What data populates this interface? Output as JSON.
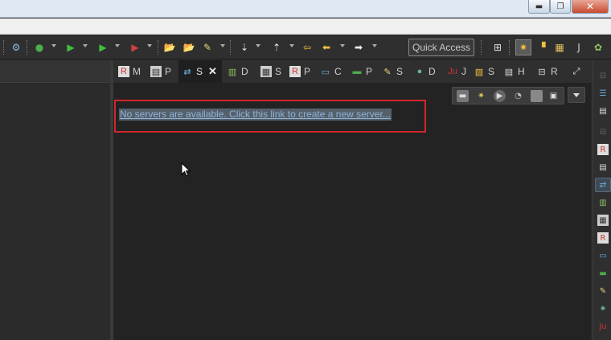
{
  "window": {
    "title": "",
    "min_glyph": "▬",
    "max_glyph": "❐",
    "close_glyph": "✕"
  },
  "toolbar": {
    "quick_access_placeholder": "Quick Access"
  },
  "view_tabs": [
    {
      "label": "M",
      "icon": "markers-icon"
    },
    {
      "label": "P",
      "icon": "properties-icon"
    },
    {
      "label": "S",
      "icon": "servers-icon",
      "active": true
    },
    {
      "label": "D",
      "icon": "data-source-explorer-icon"
    },
    {
      "label": "S",
      "icon": "snippets-icon"
    },
    {
      "label": "P",
      "icon": "problems-icon"
    },
    {
      "label": "C",
      "icon": "console-icon"
    },
    {
      "label": "P",
      "icon": "progress-icon"
    },
    {
      "label": "S",
      "icon": "search-icon"
    },
    {
      "label": "D",
      "icon": "debug-icon"
    },
    {
      "label": "J",
      "icon": "junit-icon"
    },
    {
      "label": "S",
      "icon": "synchronize-icon"
    },
    {
      "label": "H",
      "icon": "history-icon"
    },
    {
      "label": "R",
      "icon": "remote-systems-icon"
    }
  ],
  "servers_view": {
    "empty_message": "No servers are available. Click this link to create a new server..."
  },
  "colors": {
    "highlight_box": "#d0262b",
    "link": "#8fb3d9"
  }
}
